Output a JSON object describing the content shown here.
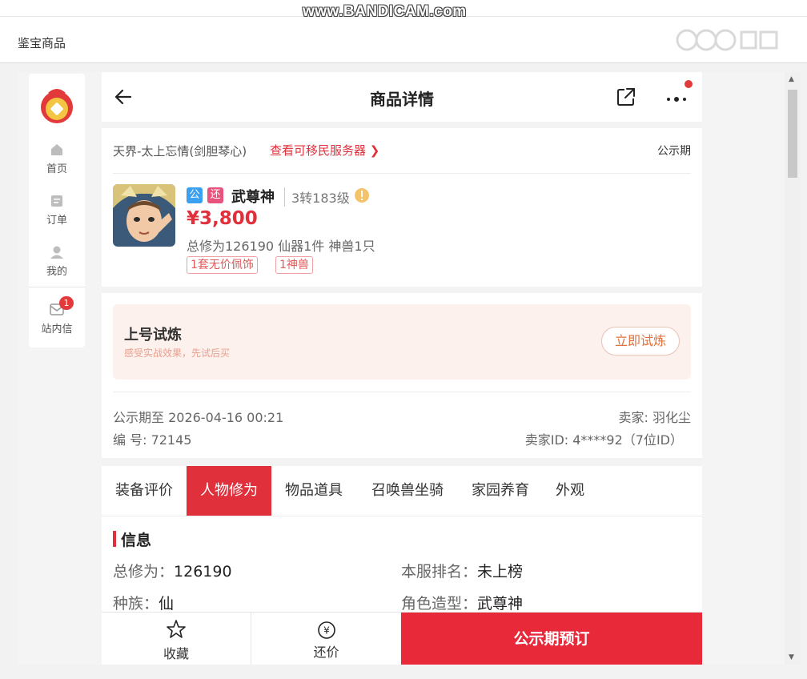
{
  "watermark": "www.BANDICAM.com",
  "app": {
    "title": "鉴宝商品"
  },
  "sidebar": {
    "items": [
      {
        "label": "首页",
        "icon": "home-icon"
      },
      {
        "label": "订单",
        "icon": "order-icon"
      },
      {
        "label": "我的",
        "icon": "user-icon"
      },
      {
        "label": "站内信",
        "icon": "mail-icon",
        "badge": "1"
      }
    ]
  },
  "header": {
    "title": "商品详情"
  },
  "product": {
    "server": "天界-太上忘情(剑胆琴心)",
    "migrate_link": "查看可移民服务器",
    "status": "公示期",
    "tag_public": "公",
    "tag_return": "还",
    "role_name": "武尊神",
    "level": "3转183级",
    "price": "¥3,800",
    "summary": "总修为126190  仙器1件  神兽1只",
    "chips": [
      "1套无价佩饰",
      "1神兽"
    ]
  },
  "trial": {
    "title": "上号试炼",
    "subtitle": "感受实战效果，先试后买",
    "button": "立即试炼"
  },
  "meta": {
    "public_until": "公示期至 2026-04-16 00:21",
    "serial": "编 号: 72145",
    "seller": "卖家: 羽化尘",
    "seller_id": "卖家ID: 4****92（7位ID）"
  },
  "tabs": [
    {
      "label": "装备评价",
      "active": false
    },
    {
      "label": "人物修为",
      "active": true
    },
    {
      "label": "物品道具",
      "active": false
    },
    {
      "label": "召唤兽坐骑",
      "active": false
    },
    {
      "label": "家园养育",
      "active": false
    },
    {
      "label": "外观",
      "active": false
    }
  ],
  "info": {
    "title": "信息",
    "fields": [
      {
        "label": "总修为：",
        "value": "126190"
      },
      {
        "label": "本服排名：",
        "value": "未上榜"
      },
      {
        "label": "种族：",
        "value": "仙"
      },
      {
        "label": "角色造型：",
        "value": "武尊神"
      }
    ]
  },
  "bottom": {
    "favorite": "收藏",
    "bargain": "还价",
    "bargain_symbol": "¥",
    "book": "公示期预订"
  },
  "colors": {
    "accent": "#e0303c",
    "trial_bg": "#fdf1ee",
    "tag_blue": "#3aa0ef",
    "tag_pink": "#e7537c"
  }
}
